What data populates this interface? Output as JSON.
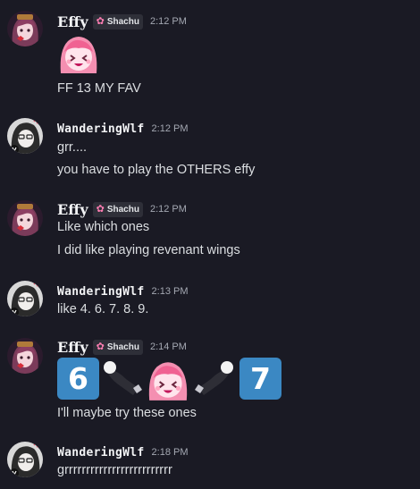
{
  "colors": {
    "background": "#1a1a24",
    "text": "#dbdee1",
    "timestamp": "#a4a8b2",
    "keycap_blue": "#3b88c3",
    "tag_icon_pink": "#ff7eb3"
  },
  "users": {
    "effy": {
      "name": "Effy",
      "tag": "Shachu",
      "tag_icon": "sakura-icon"
    },
    "wandering": {
      "name": "WanderingWlf"
    }
  },
  "messages": [
    {
      "author": "Effy",
      "time": "2:12 PM",
      "emote": "pink-hair-anime-girl-emote",
      "lines": [
        "FF 13 MY FAV"
      ]
    },
    {
      "author": "WanderingWlf",
      "time": "2:12 PM",
      "lines": [
        "grr....",
        "you have to play the OTHERS effy"
      ]
    },
    {
      "author": "Effy",
      "time": "2:12 PM",
      "lines": [
        "Like which ones",
        "I did like playing revenant wings"
      ]
    },
    {
      "author": "WanderingWlf",
      "time": "2:13 PM",
      "lines": [
        "like 4. 6. 7. 8. 9."
      ]
    },
    {
      "author": "Effy",
      "time": "2:14 PM",
      "emoji_row": [
        "6",
        "arm-reaching-emote",
        "pink-hair-anime-girl-emote",
        "arm-reaching-emote",
        "7"
      ],
      "lines": [
        "I'll maybe try these ones"
      ]
    },
    {
      "author": "WanderingWlf",
      "time": "2:18 PM",
      "lines": [
        "grrrrrrrrrrrrrrrrrrrrrrrrr"
      ]
    }
  ]
}
